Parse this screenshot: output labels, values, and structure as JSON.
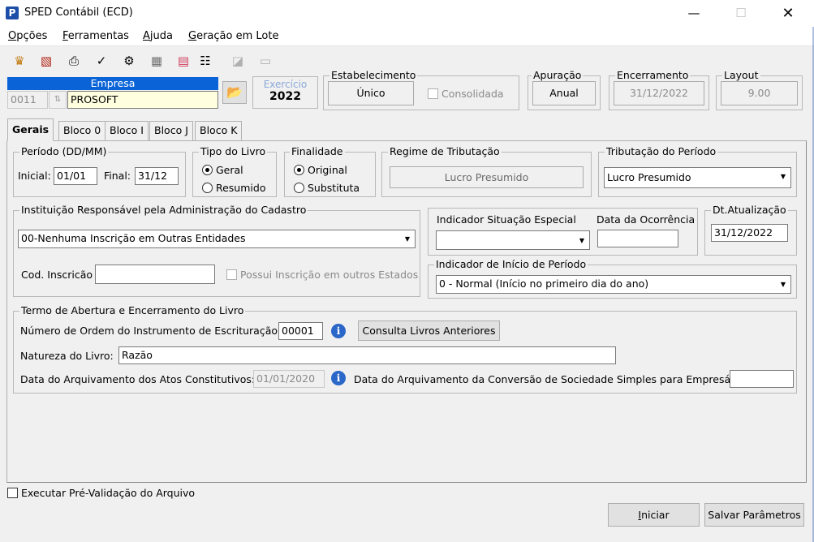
{
  "window": {
    "title": "SPED Contábil (ECD)",
    "icon": "P"
  },
  "menu": [
    {
      "pre": "",
      "u": "O",
      "post": "pções"
    },
    {
      "pre": "",
      "u": "F",
      "post": "erramentas"
    },
    {
      "pre": "",
      "u": "A",
      "post": "juda"
    },
    {
      "pre": "",
      "u": "G",
      "post": "eração em Lote"
    }
  ],
  "empresa": {
    "header": "Empresa",
    "code": "0011",
    "name": "PROSOFT"
  },
  "exercicio": {
    "label": "Exercício",
    "value": "2022"
  },
  "estabelecimento": {
    "label": "Estabelecimento",
    "value": "Único",
    "consolidada": "Consolidada"
  },
  "apuracao": {
    "label": "Apuração",
    "value": "Anual"
  },
  "encerramento": {
    "label": "Encerramento",
    "value": "31/12/2022"
  },
  "layout": {
    "label": "Layout",
    "value": "9.00"
  },
  "tabs": [
    "Gerais",
    "Bloco 0",
    "Bloco I",
    "Bloco J",
    "Bloco K"
  ],
  "periodo": {
    "label": "Período (DD/MM)",
    "inicial_label": "Inicial:",
    "inicial": "01/01",
    "final_label": "Final:",
    "final": "31/12"
  },
  "tipo_livro": {
    "label": "Tipo do Livro",
    "opt1": "Geral",
    "opt2": "Resumido"
  },
  "finalidade": {
    "label": "Finalidade",
    "opt1": "Original",
    "opt2": "Substituta"
  },
  "regime": {
    "label": "Regime de Tributação",
    "value": "Lucro Presumido"
  },
  "tributacao": {
    "label": "Tributação do Período",
    "value": "Lucro Presumido"
  },
  "instituicao": {
    "label": "Instituição Responsável pela Administração do Cadastro",
    "value": "00-Nenhuma Inscrição em Outras Entidades",
    "cod_label": "Cod. Inscricão",
    "cod_value": "",
    "possui": "Possui Inscrição em outros Estados"
  },
  "situacao": {
    "ind_label": "Indicador Situação Especial",
    "ind_value": "",
    "data_label": "Data da Ocorrência",
    "data_value": ""
  },
  "dt_atualizacao": {
    "label": "Dt.Atualização",
    "value": "31/12/2022"
  },
  "inicio_periodo": {
    "label": "Indicador de Início de Período",
    "value": "0 - Normal (Início no primeiro dia do ano)"
  },
  "termo": {
    "label": "Termo de Abertura e Encerramento do Livro",
    "ordem_label": "Número de Ordem do Instrumento de Escrituração:",
    "ordem_value": "00001",
    "consulta_btn": "Consulta Livros Anteriores",
    "natureza_label": "Natureza do Livro:",
    "natureza_value": "Razão",
    "arquivamento_label": "Data do Arquivamento dos Atos Constitutivos:",
    "arquivamento_value": "01/01/2020",
    "conversao_label": "Data do Arquivamento da Conversão de Sociedade Simples para Empresária:",
    "conversao_value": ""
  },
  "prevalidacao": "Executar Pré-Validação do Arquivo",
  "buttons": {
    "iniciar": "Iniciar",
    "salvar": "Salvar Parâmetros"
  }
}
